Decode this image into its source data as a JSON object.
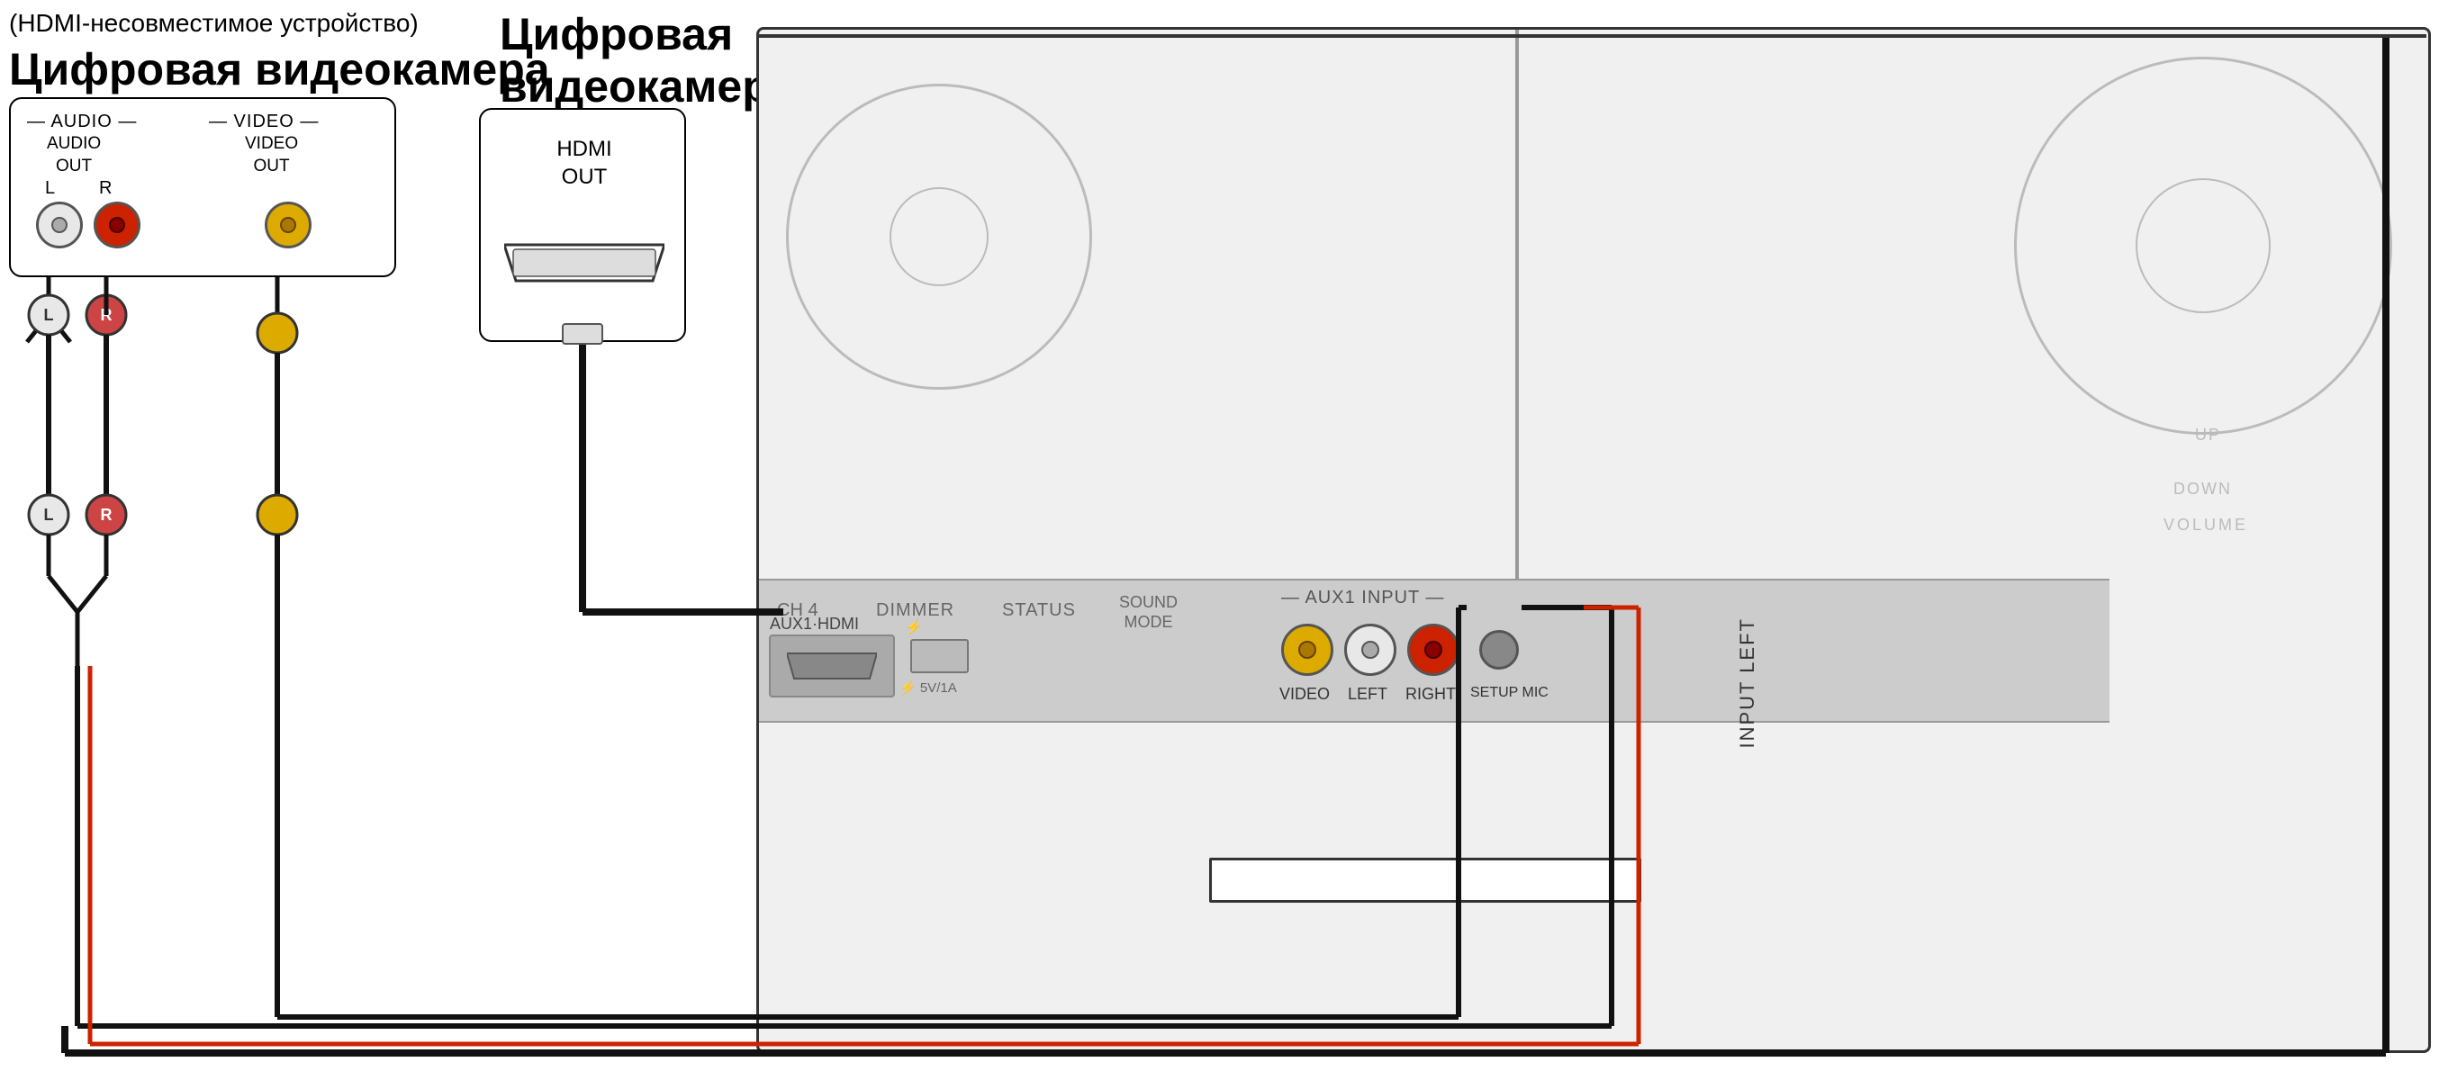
{
  "labels": {
    "device_left_subtitle": "(HDMI-несовместимое устройство)",
    "device_left_title": "Цифровая видеокамера",
    "device_mid_title": "Цифровая\nвидеокамера",
    "audio_section": "— AUDIO —",
    "video_section": "— VIDEO —",
    "audio_out": "AUDIO\nOUT",
    "video_out": "VIDEO\nOUT",
    "lr_label": "L    R",
    "hdmi_out": "HDMI\nOUT",
    "aux1_input": "— AUX1 INPUT —",
    "aux1_hdmi": "AUX1·HDMI",
    "panel_video": "VIDEO",
    "panel_left": "LEFT",
    "panel_right": "RIGHT",
    "panel_setup_mic": "SETUP MIC",
    "panel_ch4": "CH 4",
    "panel_dimmer": "DIMMER",
    "panel_status": "STATUS",
    "panel_sound_mode": "SOUND\nMODE",
    "usb_symbol": "⚡ 5V/1A",
    "volume_up": "UP",
    "volume_down": "DOWN",
    "volume": "VOLUME",
    "input_left": "INPUT LEFT",
    "plug_L": "L",
    "plug_R": "R"
  },
  "colors": {
    "wire_black": "#111111",
    "rca_white": "#e8e8e8",
    "rca_red": "#cc2200",
    "rca_yellow": "#ddaa00",
    "device_border": "#000000",
    "panel_bg": "#cccccc",
    "main_device_bg": "#f0f0f0"
  }
}
